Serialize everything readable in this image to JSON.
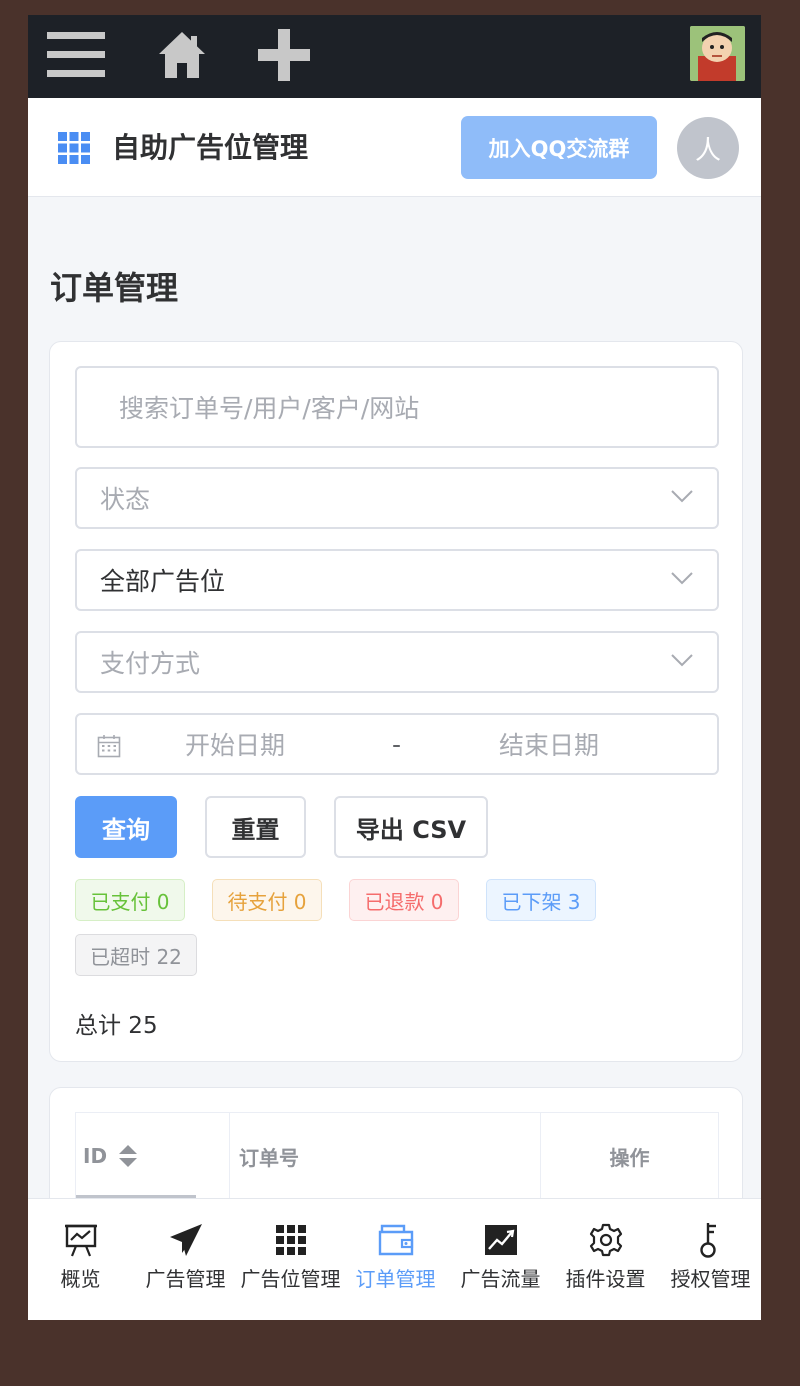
{
  "header": {
    "title": "自助广告位管理",
    "qq_button": "加入QQ交流群",
    "avatar_letter": "人"
  },
  "page": {
    "title": "订单管理"
  },
  "filters": {
    "search_placeholder": "搜索订单号/用户/客户/网站",
    "status_placeholder": "状态",
    "slot_value": "全部广告位",
    "payment_placeholder": "支付方式",
    "start_date_placeholder": "开始日期",
    "date_separator": "-",
    "end_date_placeholder": "结束日期"
  },
  "buttons": {
    "query": "查询",
    "reset": "重置",
    "export": "导出 CSV"
  },
  "status_tags": {
    "paid": "已支付 0",
    "pending": "待支付 0",
    "refunded": "已退款 0",
    "removed": "已下架 3",
    "expired": "已超时 22"
  },
  "summary": {
    "total": "总计 25"
  },
  "table": {
    "columns": [
      "ID",
      "订单号",
      "操作"
    ]
  },
  "tabbar": {
    "items": [
      {
        "label": "概览",
        "icon": "presentation-chart-icon"
      },
      {
        "label": "广告管理",
        "icon": "paper-plane-icon"
      },
      {
        "label": "广告位管理",
        "icon": "grid-icon"
      },
      {
        "label": "订单管理",
        "icon": "wallet-icon",
        "active": true
      },
      {
        "label": "广告流量",
        "icon": "trend-chart-icon"
      },
      {
        "label": "插件设置",
        "icon": "gear-icon"
      },
      {
        "label": "授权管理",
        "icon": "key-icon"
      }
    ]
  },
  "colors": {
    "primary": "#5b9cf8",
    "topbar": "#1d2127",
    "qq_button": "#8fbcf9"
  }
}
